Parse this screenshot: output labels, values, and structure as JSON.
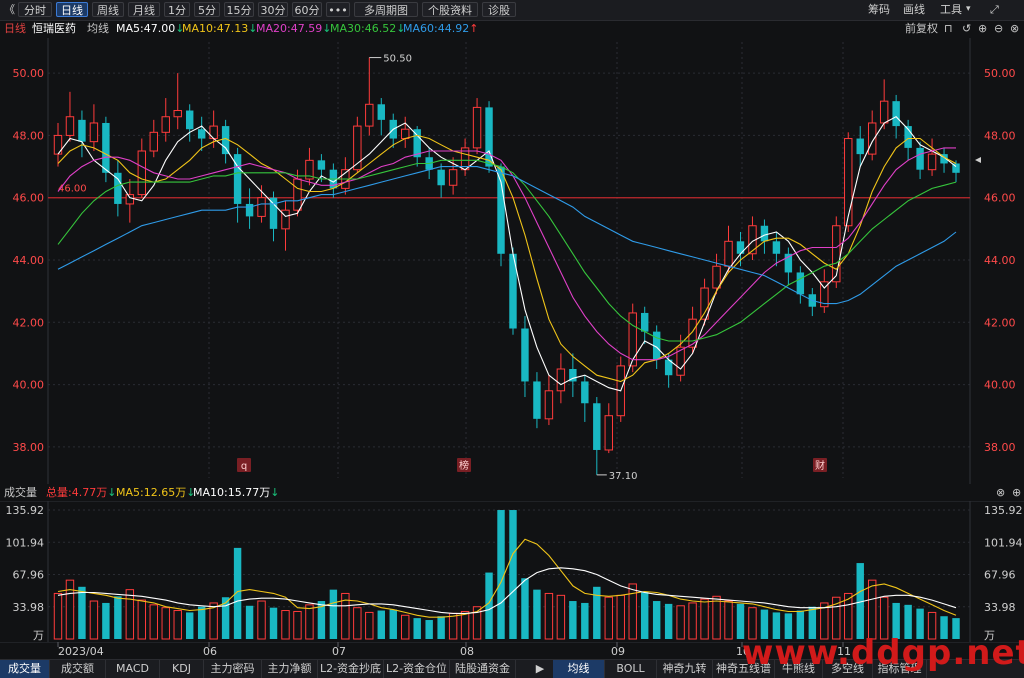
{
  "toolbar": {
    "back_glyph": "《",
    "items": [
      "分时",
      "日线",
      "周线",
      "月线",
      "1分",
      "5分",
      "15分",
      "30分",
      "60分",
      "•••",
      "多周期图",
      "个股资料",
      "诊股"
    ],
    "active_index": 1,
    "right": [
      "筹码",
      "画线",
      "工具"
    ],
    "multi_chevron": "⌄"
  },
  "info": {
    "period": "日线",
    "name": "恒瑞医药",
    "avg_label": "均线",
    "ma5": "MA5:47.00",
    "ma10": "MA10:47.13",
    "ma20": "MA20:47.59",
    "ma30": "MA30:46.52",
    "ma60": "MA60:44.92",
    "ma5_arrow": "↓",
    "ma10_arrow": "↓",
    "ma20_arrow": "↓",
    "ma30_arrow": "↓",
    "ma60_arrow": "↑",
    "adjust": "前复权"
  },
  "colors": {
    "up": "#ff3b3b",
    "down": "#19b8c3",
    "ma5": "#ffffff",
    "ma10": "#f0c419",
    "ma20": "#e040c8",
    "ma30": "#36c53c",
    "ma60": "#2f9be8",
    "grid": "#2a2c33",
    "hline": "#c0282c"
  },
  "price_axis": {
    "labels": [
      "50.00",
      "48.00",
      "46.00",
      "44.00",
      "42.00",
      "40.00",
      "38.00"
    ],
    "ylim": [
      37.0,
      51.0
    ],
    "ref_line_label": "46.00",
    "high_label": "50.50",
    "low_label": "37.10"
  },
  "event_markers": [
    "q",
    "榜",
    "财"
  ],
  "volume": {
    "title": "成交量",
    "total": "总量:4.77万",
    "total_arrow": "↓",
    "ma5": "MA5:12.65万",
    "ma5_arrow": "↓",
    "ma10": "MA10:15.77万",
    "ma10_arrow": "↓",
    "axis_labels": [
      "135.92",
      "101.94",
      "67.96",
      "33.98",
      "万"
    ]
  },
  "date_axis": [
    "2023/04",
    "06",
    "07",
    "08",
    "09",
    "10",
    "11"
  ],
  "bottom_tabs": {
    "left": [
      "成交量",
      "成交额",
      "MACD",
      "KDJ",
      "主力密码",
      "主力净额",
      "L2-资金抄底",
      "L2-资金仓位",
      "陆股通资金"
    ],
    "left_active": 0,
    "right": [
      "均线",
      "BOLL",
      "神奇九转",
      "神奇五线谱",
      "牛熊线",
      "多空线",
      "指标管理"
    ],
    "right_active": 0
  },
  "watermark": "www.ddgp.net",
  "chart_data": {
    "type": "candlestick",
    "title": "",
    "ylim": [
      37.0,
      51.0
    ],
    "ma_series": [
      {
        "name": "MA5",
        "values": [
          47.4,
          47.9,
          47.8,
          47.2,
          46.9,
          46.6,
          46.0,
          45.9,
          46.4,
          47.2,
          47.8,
          48.1,
          48.3,
          47.9,
          47.6,
          47.0,
          46.6,
          46.2,
          45.8,
          45.4,
          45.5,
          46.2,
          46.7,
          46.5,
          46.8,
          47.1,
          47.4,
          47.8,
          48.2,
          48.4,
          48.0,
          47.6,
          47.3,
          47.1,
          46.9,
          47.2,
          47.5,
          46.5,
          44.2,
          42.4,
          41.2,
          40.3,
          40.0,
          40.2,
          40.3,
          40.1,
          39.9,
          39.8,
          40.8,
          41.4,
          41.2,
          40.8,
          40.5,
          41.0,
          42.0,
          43.0,
          43.7,
          44.2,
          44.6,
          44.8,
          44.9,
          44.6,
          44.0,
          43.6,
          43.1,
          43.5,
          45.4,
          47.0,
          47.8,
          48.4,
          48.6,
          48.2,
          47.7,
          47.5,
          47.3,
          47.0
        ],
        "x_end_index": 75
      },
      {
        "name": "MA10",
        "values": [
          47.1,
          47.5,
          47.7,
          47.6,
          47.4,
          47.2,
          46.8,
          46.6,
          46.5,
          46.6,
          46.9,
          47.2,
          47.6,
          47.8,
          47.9,
          47.7,
          47.4,
          47.1,
          46.9,
          46.6,
          46.3,
          46.2,
          46.2,
          46.3,
          46.5,
          46.8,
          47.1,
          47.4,
          47.7,
          47.9,
          48.0,
          47.9,
          47.7,
          47.5,
          47.4,
          47.3,
          47.2,
          46.9,
          46.0,
          44.8,
          43.4,
          42.1,
          41.3,
          40.9,
          40.6,
          40.3,
          40.2,
          40.1,
          40.3,
          40.7,
          40.8,
          41.0,
          41.3,
          41.7,
          42.3,
          43.0,
          43.6,
          44.0,
          44.3,
          44.6,
          44.7,
          44.7,
          44.5,
          44.2,
          43.9,
          43.7,
          44.2,
          45.1,
          46.2,
          47.0,
          47.6,
          47.9,
          47.9,
          47.6,
          47.3,
          47.1
        ],
        "x_end_index": 75
      },
      {
        "name": "MA20",
        "values": [
          46.2,
          46.7,
          47.0,
          47.2,
          47.3,
          47.3,
          47.2,
          47.0,
          46.8,
          46.7,
          46.6,
          46.6,
          46.7,
          46.8,
          46.9,
          47.0,
          47.1,
          47.0,
          46.9,
          46.8,
          46.6,
          46.5,
          46.4,
          46.4,
          46.5,
          46.6,
          46.8,
          47.0,
          47.1,
          47.3,
          47.4,
          47.5,
          47.5,
          47.5,
          47.5,
          47.5,
          47.4,
          47.2,
          46.7,
          46.0,
          45.2,
          44.4,
          43.6,
          42.8,
          42.2,
          41.7,
          41.3,
          41.0,
          40.8,
          40.8,
          40.8,
          40.9,
          41.1,
          41.3,
          41.6,
          42.0,
          42.4,
          42.8,
          43.2,
          43.6,
          43.9,
          44.1,
          44.3,
          44.4,
          44.4,
          44.4,
          44.7,
          45.2,
          45.8,
          46.4,
          46.9,
          47.2,
          47.4,
          47.5,
          47.6,
          47.6
        ],
        "x_end_index": 75
      },
      {
        "name": "MA30",
        "values": [
          44.5,
          45.0,
          45.5,
          45.9,
          46.2,
          46.4,
          46.5,
          46.5,
          46.5,
          46.5,
          46.5,
          46.5,
          46.6,
          46.7,
          46.7,
          46.8,
          46.8,
          46.8,
          46.8,
          46.8,
          46.7,
          46.7,
          46.6,
          46.6,
          46.6,
          46.6,
          46.7,
          46.8,
          46.9,
          47.0,
          47.1,
          47.1,
          47.2,
          47.2,
          47.2,
          47.2,
          47.1,
          47.0,
          46.8,
          46.4,
          45.9,
          45.4,
          44.8,
          44.2,
          43.6,
          43.1,
          42.6,
          42.2,
          41.9,
          41.7,
          41.5,
          41.4,
          41.4,
          41.4,
          41.5,
          41.6,
          41.8,
          42.0,
          42.3,
          42.6,
          42.9,
          43.2,
          43.4,
          43.6,
          43.8,
          43.9,
          44.2,
          44.6,
          45.0,
          45.3,
          45.6,
          45.9,
          46.1,
          46.3,
          46.4,
          46.5
        ],
        "x_end_index": 75
      },
      {
        "name": "MA60",
        "values": [
          43.7,
          43.9,
          44.1,
          44.3,
          44.5,
          44.7,
          44.9,
          45.1,
          45.2,
          45.3,
          45.4,
          45.5,
          45.6,
          45.6,
          45.6,
          45.7,
          45.7,
          45.8,
          45.8,
          45.9,
          45.9,
          46.0,
          46.1,
          46.1,
          46.2,
          46.3,
          46.4,
          46.5,
          46.6,
          46.7,
          46.8,
          46.9,
          47.0,
          47.0,
          47.0,
          47.0,
          46.9,
          46.8,
          46.7,
          46.5,
          46.3,
          46.1,
          45.9,
          45.7,
          45.4,
          45.2,
          45.0,
          44.8,
          44.6,
          44.5,
          44.4,
          44.3,
          44.2,
          44.1,
          44.0,
          43.9,
          43.8,
          43.7,
          43.6,
          43.5,
          43.3,
          43.1,
          42.9,
          42.7,
          42.6,
          42.6,
          42.7,
          42.9,
          43.2,
          43.5,
          43.8,
          44.0,
          44.2,
          44.4,
          44.6,
          44.9
        ],
        "x_end_index": 75
      }
    ],
    "candles": [
      {
        "o": 47.4,
        "c": 48.0,
        "h": 48.4,
        "l": 47.0
      },
      {
        "o": 48.0,
        "c": 48.6,
        "h": 49.4,
        "l": 47.8
      },
      {
        "o": 48.5,
        "c": 47.8,
        "h": 48.8,
        "l": 47.3
      },
      {
        "o": 47.8,
        "c": 48.4,
        "h": 49.0,
        "l": 47.5
      },
      {
        "o": 48.4,
        "c": 46.8,
        "h": 48.6,
        "l": 46.5
      },
      {
        "o": 46.8,
        "c": 45.8,
        "h": 47.2,
        "l": 45.4
      },
      {
        "o": 45.8,
        "c": 46.1,
        "h": 46.6,
        "l": 45.2
      },
      {
        "o": 46.1,
        "c": 47.5,
        "h": 47.9,
        "l": 46.0
      },
      {
        "o": 47.5,
        "c": 48.1,
        "h": 48.5,
        "l": 47.3
      },
      {
        "o": 48.1,
        "c": 48.6,
        "h": 49.2,
        "l": 47.8
      },
      {
        "o": 48.6,
        "c": 48.8,
        "h": 50.0,
        "l": 48.2
      },
      {
        "o": 48.8,
        "c": 48.2,
        "h": 49.0,
        "l": 47.8
      },
      {
        "o": 48.2,
        "c": 47.9,
        "h": 48.6,
        "l": 47.5
      },
      {
        "o": 47.9,
        "c": 48.3,
        "h": 48.8,
        "l": 47.6
      },
      {
        "o": 48.3,
        "c": 47.4,
        "h": 48.5,
        "l": 47.1
      },
      {
        "o": 47.4,
        "c": 45.8,
        "h": 47.6,
        "l": 45.2
      },
      {
        "o": 45.8,
        "c": 45.4,
        "h": 46.3,
        "l": 45.0
      },
      {
        "o": 45.4,
        "c": 46.0,
        "h": 46.4,
        "l": 45.2
      },
      {
        "o": 46.0,
        "c": 45.0,
        "h": 46.2,
        "l": 44.6
      },
      {
        "o": 45.0,
        "c": 45.6,
        "h": 45.9,
        "l": 44.3
      },
      {
        "o": 45.6,
        "c": 46.6,
        "h": 46.9,
        "l": 45.4
      },
      {
        "o": 46.6,
        "c": 47.2,
        "h": 47.6,
        "l": 46.4
      },
      {
        "o": 47.2,
        "c": 46.9,
        "h": 47.4,
        "l": 46.5
      },
      {
        "o": 46.9,
        "c": 46.3,
        "h": 47.1,
        "l": 46.0
      },
      {
        "o": 46.3,
        "c": 46.9,
        "h": 47.3,
        "l": 46.1
      },
      {
        "o": 46.9,
        "c": 48.3,
        "h": 48.6,
        "l": 46.8
      },
      {
        "o": 48.3,
        "c": 49.0,
        "h": 50.5,
        "l": 48.0
      },
      {
        "o": 49.0,
        "c": 48.5,
        "h": 49.2,
        "l": 48.0
      },
      {
        "o": 48.5,
        "c": 47.9,
        "h": 48.7,
        "l": 47.6
      },
      {
        "o": 47.9,
        "c": 48.2,
        "h": 48.6,
        "l": 47.6
      },
      {
        "o": 48.2,
        "c": 47.3,
        "h": 48.3,
        "l": 47.0
      },
      {
        "o": 47.3,
        "c": 46.9,
        "h": 47.6,
        "l": 46.6
      },
      {
        "o": 46.9,
        "c": 46.4,
        "h": 47.1,
        "l": 46.0
      },
      {
        "o": 46.4,
        "c": 46.9,
        "h": 47.3,
        "l": 46.1
      },
      {
        "o": 46.9,
        "c": 47.6,
        "h": 47.9,
        "l": 46.7
      },
      {
        "o": 47.6,
        "c": 48.9,
        "h": 49.2,
        "l": 47.4
      },
      {
        "o": 48.9,
        "c": 47.0,
        "h": 49.1,
        "l": 46.8
      },
      {
        "o": 47.0,
        "c": 44.2,
        "h": 47.1,
        "l": 43.8
      },
      {
        "o": 44.2,
        "c": 41.8,
        "h": 44.4,
        "l": 41.6
      },
      {
        "o": 41.8,
        "c": 40.1,
        "h": 42.2,
        "l": 39.6
      },
      {
        "o": 40.1,
        "c": 38.9,
        "h": 40.4,
        "l": 38.6
      },
      {
        "o": 38.9,
        "c": 39.8,
        "h": 40.3,
        "l": 38.7
      },
      {
        "o": 39.8,
        "c": 40.5,
        "h": 41.0,
        "l": 39.4
      },
      {
        "o": 40.5,
        "c": 40.1,
        "h": 41.0,
        "l": 39.6
      },
      {
        "o": 40.1,
        "c": 39.4,
        "h": 40.3,
        "l": 38.8
      },
      {
        "o": 39.4,
        "c": 37.9,
        "h": 39.6,
        "l": 37.1
      },
      {
        "o": 37.9,
        "c": 39.0,
        "h": 39.4,
        "l": 37.8
      },
      {
        "o": 39.0,
        "c": 40.6,
        "h": 40.9,
        "l": 38.8
      },
      {
        "o": 40.6,
        "c": 42.3,
        "h": 42.6,
        "l": 40.4
      },
      {
        "o": 42.3,
        "c": 41.7,
        "h": 42.5,
        "l": 41.3
      },
      {
        "o": 41.7,
        "c": 40.8,
        "h": 41.9,
        "l": 40.5
      },
      {
        "o": 40.8,
        "c": 40.3,
        "h": 41.0,
        "l": 39.9
      },
      {
        "o": 40.3,
        "c": 41.2,
        "h": 41.6,
        "l": 40.1
      },
      {
        "o": 41.2,
        "c": 42.1,
        "h": 42.5,
        "l": 41.0
      },
      {
        "o": 42.1,
        "c": 43.1,
        "h": 43.4,
        "l": 41.9
      },
      {
        "o": 43.1,
        "c": 43.8,
        "h": 44.2,
        "l": 42.9
      },
      {
        "o": 43.8,
        "c": 44.6,
        "h": 45.1,
        "l": 43.6
      },
      {
        "o": 44.6,
        "c": 44.2,
        "h": 44.9,
        "l": 43.8
      },
      {
        "o": 44.2,
        "c": 45.1,
        "h": 45.4,
        "l": 44.0
      },
      {
        "o": 45.1,
        "c": 44.6,
        "h": 45.3,
        "l": 44.2
      },
      {
        "o": 44.6,
        "c": 44.2,
        "h": 44.9,
        "l": 43.8
      },
      {
        "o": 44.2,
        "c": 43.6,
        "h": 44.4,
        "l": 43.2
      },
      {
        "o": 43.6,
        "c": 42.9,
        "h": 43.8,
        "l": 42.6
      },
      {
        "o": 42.9,
        "c": 42.5,
        "h": 43.1,
        "l": 42.2
      },
      {
        "o": 42.5,
        "c": 43.3,
        "h": 43.7,
        "l": 42.3
      },
      {
        "o": 43.3,
        "c": 45.1,
        "h": 45.4,
        "l": 43.1
      },
      {
        "o": 45.1,
        "c": 47.9,
        "h": 48.1,
        "l": 44.9
      },
      {
        "o": 47.9,
        "c": 47.4,
        "h": 48.3,
        "l": 47.0
      },
      {
        "o": 47.4,
        "c": 48.4,
        "h": 48.8,
        "l": 47.2
      },
      {
        "o": 48.4,
        "c": 49.1,
        "h": 49.8,
        "l": 48.2
      },
      {
        "o": 49.1,
        "c": 48.3,
        "h": 49.3,
        "l": 47.9
      },
      {
        "o": 48.3,
        "c": 47.6,
        "h": 48.5,
        "l": 47.2
      },
      {
        "o": 47.6,
        "c": 46.9,
        "h": 47.8,
        "l": 46.6
      },
      {
        "o": 46.9,
        "c": 47.4,
        "h": 47.9,
        "l": 46.7
      },
      {
        "o": 47.4,
        "c": 47.1,
        "h": 47.6,
        "l": 46.8
      },
      {
        "o": 47.1,
        "c": 46.8,
        "h": 47.2,
        "l": 46.5
      }
    ],
    "volume_values": [
      48,
      62,
      55,
      40,
      38,
      45,
      52,
      41,
      36,
      33,
      30,
      28,
      34,
      38,
      44,
      96,
      35,
      40,
      33,
      30,
      29,
      36,
      40,
      52,
      48,
      33,
      28,
      30,
      31,
      25,
      22,
      20,
      24,
      27,
      29,
      34,
      70,
      135.9,
      135.9,
      64,
      52,
      48,
      46,
      40,
      38,
      55,
      44,
      46,
      58,
      50,
      40,
      37,
      35,
      38,
      42,
      45,
      40,
      37,
      33,
      31,
      28,
      27,
      30,
      34,
      38,
      44,
      48,
      80,
      62,
      44,
      38,
      36,
      32,
      28,
      24,
      22
    ],
    "volume_ma5": [
      50,
      52,
      50,
      48,
      46,
      43,
      42,
      40,
      38,
      34,
      32,
      30,
      31,
      33,
      38,
      50,
      52,
      50,
      48,
      44,
      33,
      32,
      34,
      38,
      41,
      40,
      37,
      33,
      31,
      28,
      25,
      23,
      23,
      24,
      26,
      29,
      38,
      60,
      90,
      105,
      100,
      88,
      72,
      56,
      48,
      46,
      45,
      46,
      48,
      50,
      49,
      46,
      42,
      40,
      39,
      40,
      39,
      38,
      37,
      34,
      31,
      29,
      29,
      31,
      33,
      37,
      42,
      50,
      56,
      58,
      54,
      48,
      42,
      36,
      30,
      25
    ],
    "volume_ma10": [
      46,
      48,
      49,
      49,
      48,
      47,
      46,
      45,
      43,
      41,
      38,
      36,
      35,
      34,
      35,
      40,
      42,
      43,
      43,
      42,
      40,
      38,
      36,
      35,
      35,
      36,
      37,
      37,
      36,
      34,
      32,
      30,
      28,
      27,
      27,
      28,
      31,
      38,
      50,
      62,
      70,
      74,
      75,
      74,
      72,
      68,
      62,
      56,
      52,
      49,
      47,
      46,
      45,
      44,
      43,
      42,
      41,
      40,
      39,
      38,
      36,
      34,
      33,
      33,
      33,
      34,
      36,
      39,
      42,
      45,
      46,
      46,
      44,
      41,
      37,
      33
    ]
  }
}
